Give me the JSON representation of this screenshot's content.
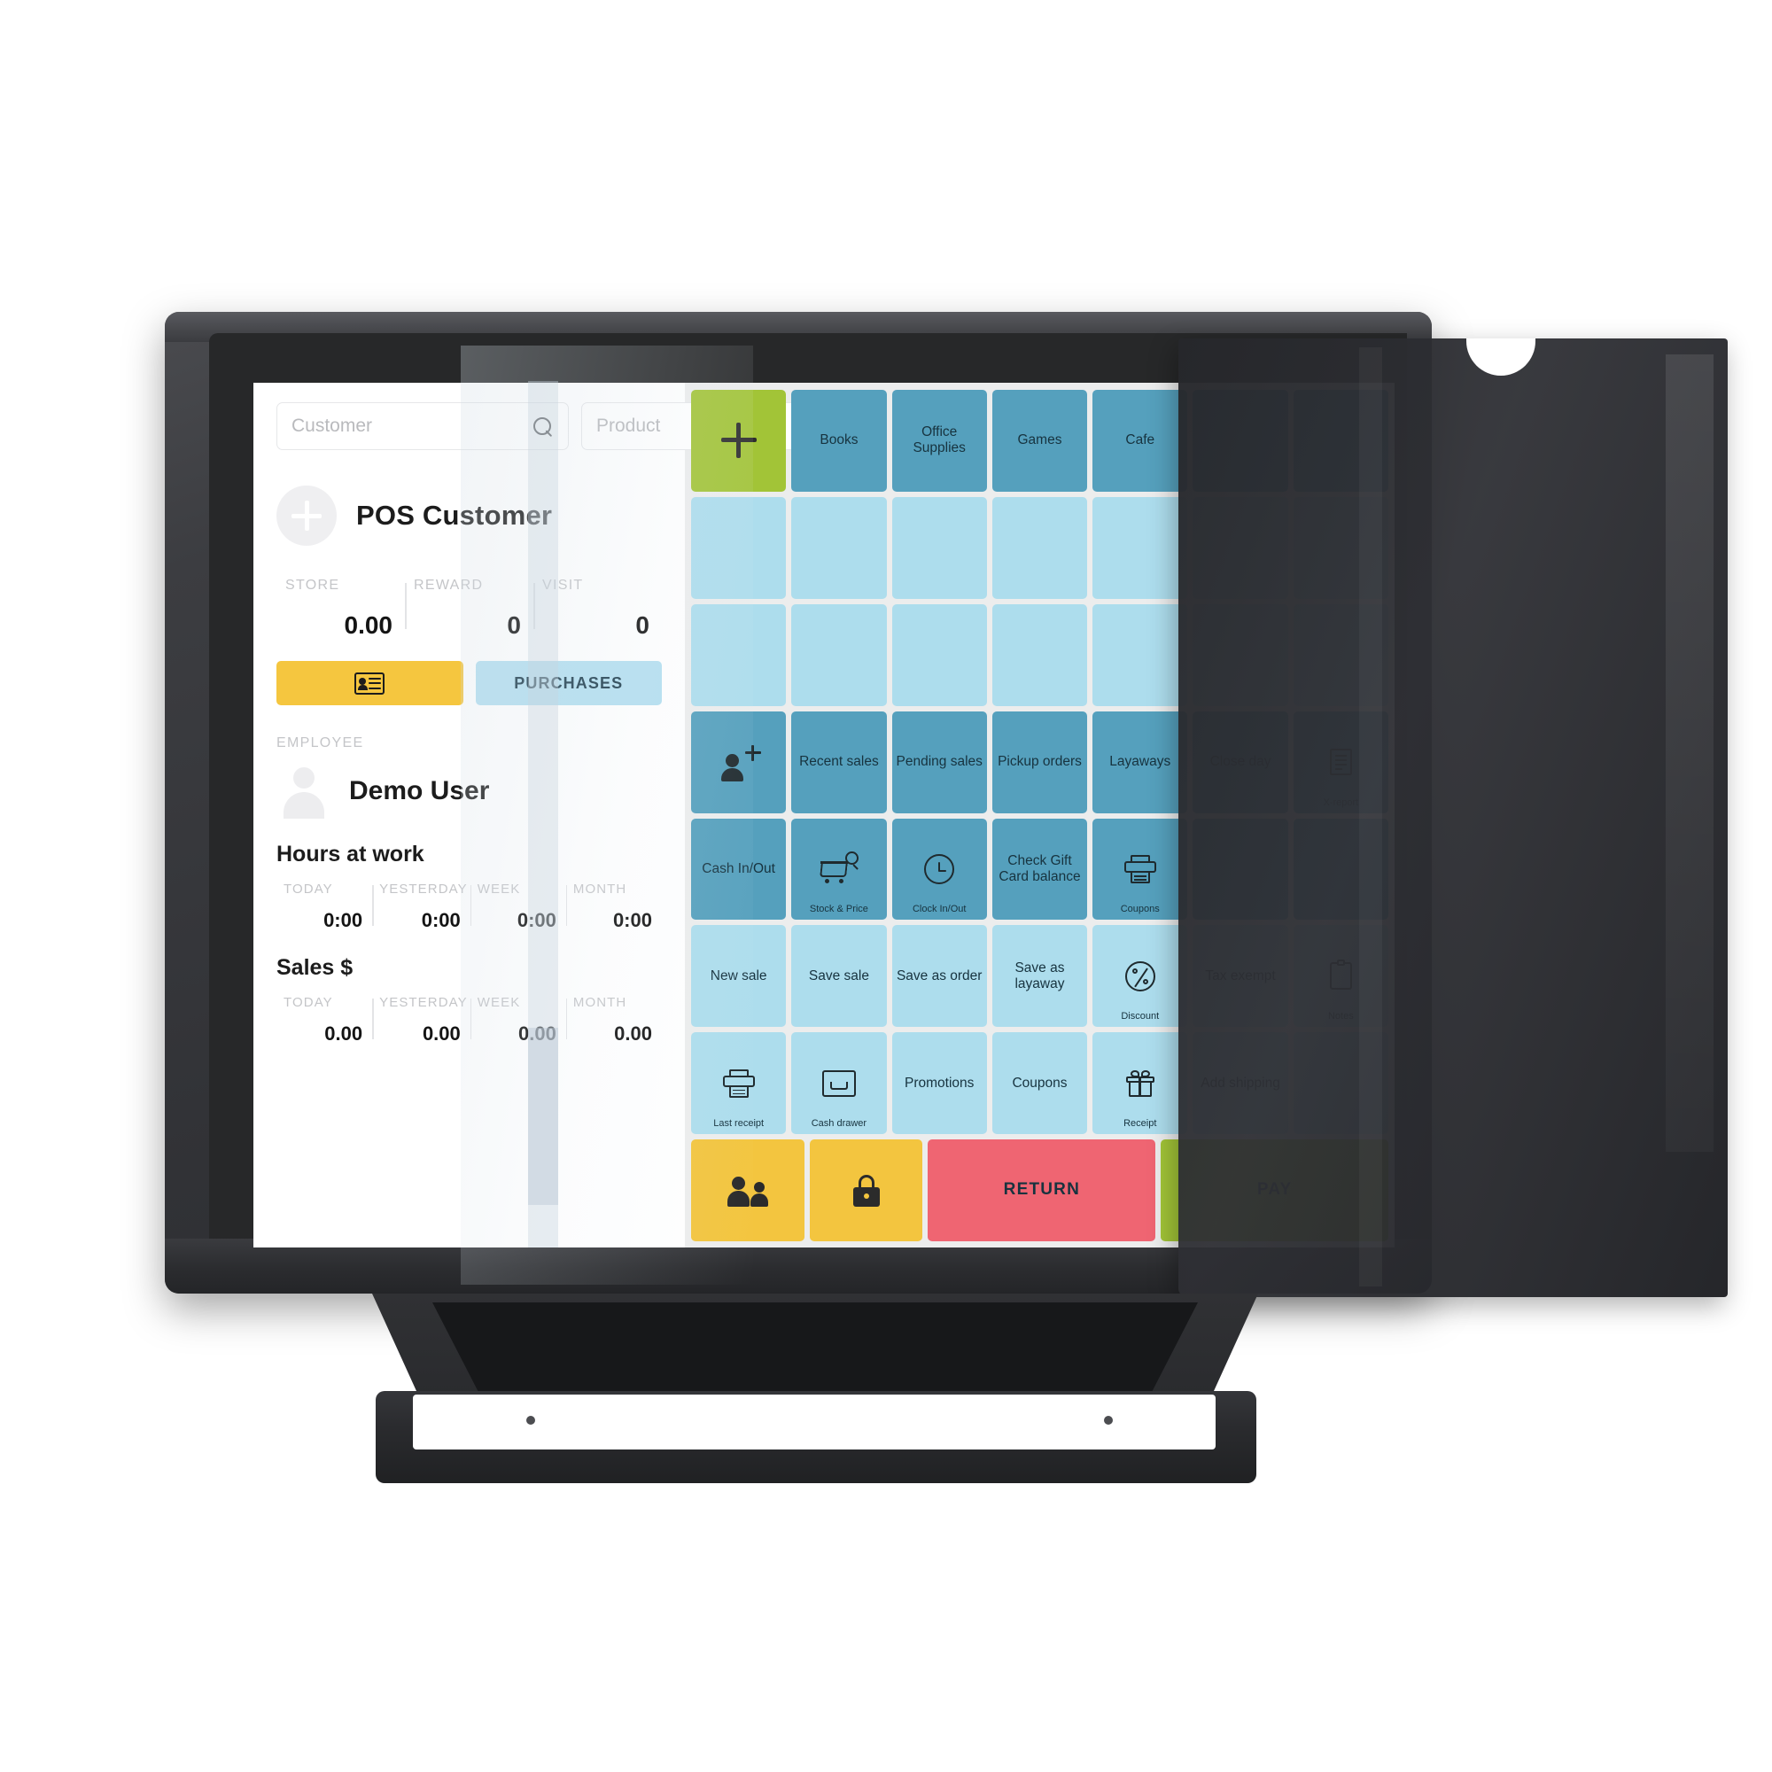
{
  "device": {
    "type": "pos-touch-terminal",
    "accent_blue": "#55a0bd",
    "accent_light_blue": "#addded",
    "accent_green": "#a2c437",
    "accent_yellow": "#f3c53f",
    "accent_red": "#ef6572"
  },
  "search": {
    "customer_placeholder": "Customer",
    "customer_value": "",
    "product_placeholder": "Product",
    "product_value": ""
  },
  "customer": {
    "name": "POS Customer",
    "stats": [
      {
        "label": "STORE",
        "value": "0.00"
      },
      {
        "label": "REWARD",
        "value": "0"
      },
      {
        "label": "VISIT",
        "value": "0"
      }
    ],
    "purchases_label": "PURCHASES"
  },
  "employee": {
    "section_label": "EMPLOYEE",
    "name": "Demo User",
    "hours": {
      "title": "Hours at work",
      "columns": [
        {
          "label": "TODAY",
          "value": "0:00"
        },
        {
          "label": "YESTERDAY",
          "value": "0:00"
        },
        {
          "label": "WEEK",
          "value": "0:00"
        },
        {
          "label": "MONTH",
          "value": "0:00"
        }
      ]
    },
    "sales": {
      "title": "Sales $",
      "columns": [
        {
          "label": "TODAY",
          "value": "0.00"
        },
        {
          "label": "YESTERDAY",
          "value": "0.00"
        },
        {
          "label": "WEEK",
          "value": "0.00"
        },
        {
          "label": "MONTH",
          "value": "0.00"
        }
      ]
    }
  },
  "grid": {
    "row1": [
      {
        "label": "",
        "icon": "plus-icon",
        "color": "green"
      },
      {
        "label": "Books",
        "icon": "",
        "color": "blue"
      },
      {
        "label": "Office Supplies",
        "icon": "",
        "color": "blue"
      },
      {
        "label": "Games",
        "icon": "",
        "color": "blue"
      },
      {
        "label": "Cafe",
        "icon": "",
        "color": "blue"
      },
      {
        "label": "",
        "icon": "",
        "color": "blue"
      },
      {
        "label": "",
        "icon": "",
        "color": "blue"
      }
    ],
    "row2": [
      {
        "label": "",
        "color": "ltblue"
      },
      {
        "label": "",
        "color": "ltblue"
      },
      {
        "label": "",
        "color": "ltblue"
      },
      {
        "label": "",
        "color": "ltblue"
      },
      {
        "label": "",
        "color": "ltblue"
      },
      {
        "label": "",
        "color": "ltblue"
      },
      {
        "label": "",
        "color": "ltblue"
      }
    ],
    "row3": [
      {
        "label": "",
        "color": "ltblue"
      },
      {
        "label": "",
        "color": "ltblue"
      },
      {
        "label": "",
        "color": "ltblue"
      },
      {
        "label": "",
        "color": "ltblue"
      },
      {
        "label": "",
        "color": "ltblue"
      },
      {
        "label": "",
        "color": "ltblue"
      },
      {
        "label": "",
        "color": "ltblue"
      }
    ],
    "row4": [
      {
        "label": "",
        "icon": "add-customer-icon",
        "color": "blue"
      },
      {
        "label": "Recent sales",
        "icon": "",
        "color": "blue"
      },
      {
        "label": "Pending sales",
        "icon": "",
        "color": "blue"
      },
      {
        "label": "Pickup orders",
        "icon": "",
        "color": "blue"
      },
      {
        "label": "Layaways",
        "icon": "",
        "color": "blue"
      },
      {
        "label": "Close day",
        "icon": "",
        "color": "blue"
      },
      {
        "label": "",
        "icon": "x-report-icon",
        "caption": "X-report",
        "color": "blue"
      }
    ],
    "row5": [
      {
        "label": "Cash In/Out",
        "icon": "",
        "color": "blue"
      },
      {
        "label": "",
        "icon": "stock-price-icon",
        "caption": "Stock & Price",
        "color": "blue"
      },
      {
        "label": "",
        "icon": "clock-icon",
        "caption": "Clock In/Out",
        "color": "blue"
      },
      {
        "label": "Check Gift Card balance",
        "icon": "",
        "color": "blue"
      },
      {
        "label": "",
        "icon": "printer-icon",
        "caption": "Coupons",
        "color": "blue"
      },
      {
        "label": "",
        "icon": "",
        "color": "blue"
      },
      {
        "label": "",
        "icon": "",
        "color": "blue"
      }
    ],
    "row6": [
      {
        "label": "New sale",
        "icon": "",
        "color": "ltblue"
      },
      {
        "label": "Save sale",
        "icon": "",
        "color": "ltblue"
      },
      {
        "label": "Save as order",
        "icon": "",
        "color": "ltblue"
      },
      {
        "label": "Save as layaway",
        "icon": "",
        "color": "ltblue"
      },
      {
        "label": "",
        "icon": "percent-icon",
        "caption": "Discount",
        "color": "ltblue"
      },
      {
        "label": "Tax exempt",
        "icon": "",
        "color": "ltblue"
      },
      {
        "label": "",
        "icon": "notes-icon",
        "caption": "Notes",
        "color": "ltblue"
      }
    ],
    "row7": [
      {
        "label": "",
        "icon": "printer-icon",
        "caption": "Last receipt",
        "color": "ltblue"
      },
      {
        "label": "",
        "icon": "cash-drawer-icon",
        "caption": "Cash drawer",
        "color": "ltblue"
      },
      {
        "label": "Promotions",
        "icon": "",
        "color": "ltblue"
      },
      {
        "label": "Coupons",
        "icon": "",
        "color": "ltblue"
      },
      {
        "label": "",
        "icon": "gift-icon",
        "caption": "Receipt",
        "color": "ltblue"
      },
      {
        "label": "Add shipping",
        "icon": "",
        "color": "ltblue"
      },
      {
        "label": "",
        "icon": "",
        "color": "ltblue"
      }
    ],
    "row8": [
      {
        "label": "",
        "icon": "people-icon",
        "color": "yellow"
      },
      {
        "label": "",
        "icon": "lock-icon",
        "color": "yellow"
      },
      {
        "label": "RETURN",
        "icon": "",
        "color": "red",
        "wide": true
      },
      {
        "label": "PAY",
        "icon": "",
        "color": "green",
        "wide": true
      }
    ]
  }
}
